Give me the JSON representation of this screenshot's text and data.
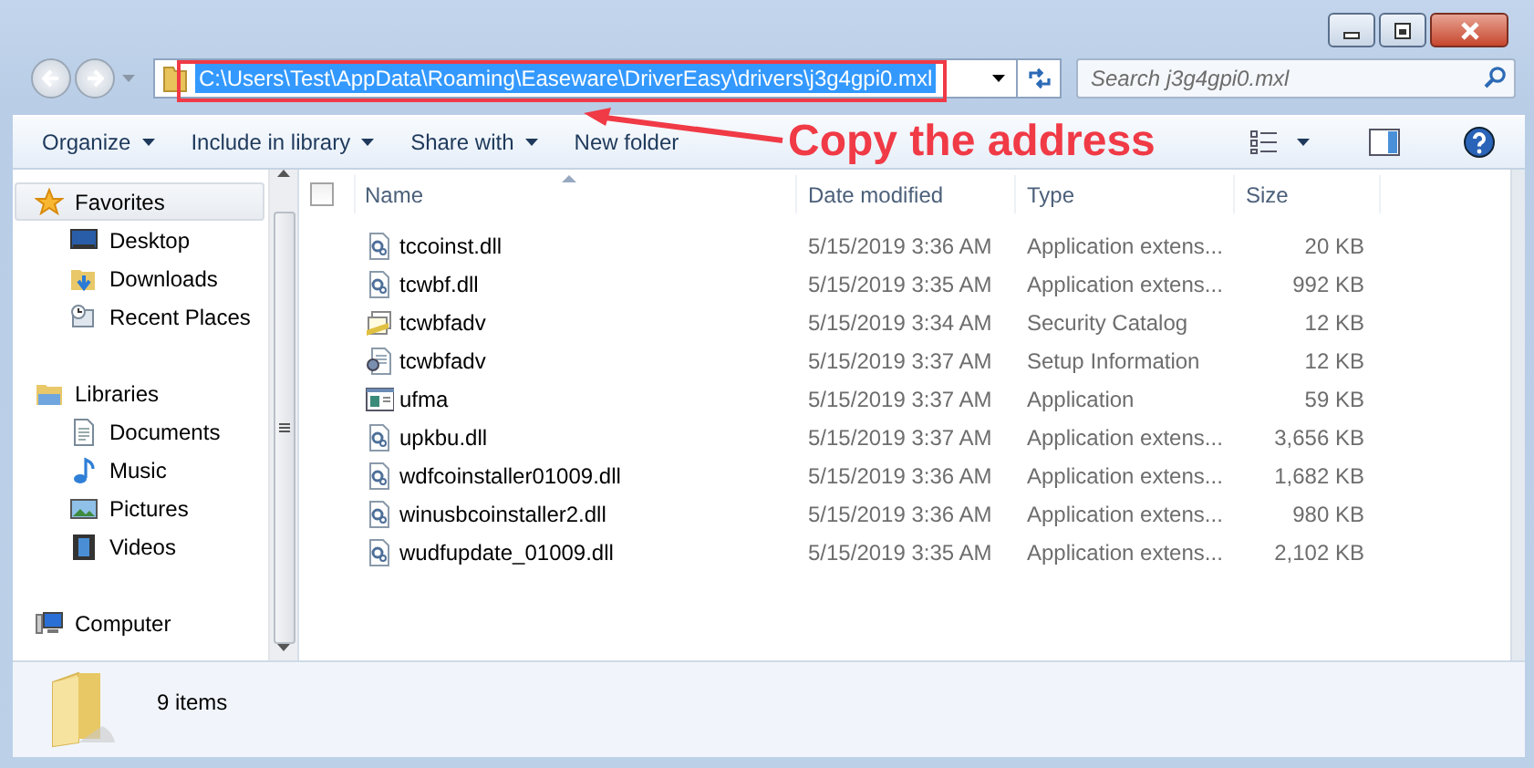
{
  "address": {
    "path": "C:\\Users\\Test\\AppData\\Roaming\\Easeware\\DriverEasy\\drivers\\j3g4gpi0.mxl",
    "selected": true
  },
  "search": {
    "placeholder": "Search j3g4gpi0.mxl"
  },
  "toolbar": [
    {
      "label": "Organize",
      "dropdown": true
    },
    {
      "label": "Include in library",
      "dropdown": true
    },
    {
      "label": "Share with",
      "dropdown": true
    },
    {
      "label": "New folder",
      "dropdown": false
    }
  ],
  "nav": [
    {
      "label": "Favorites",
      "kind": "star",
      "selected": true,
      "children": [
        {
          "label": "Desktop",
          "kind": "desktop",
          "selected": false
        },
        {
          "label": "Downloads",
          "kind": "downloads",
          "selected": false
        },
        {
          "label": "Recent Places",
          "kind": "recent",
          "selected": false
        }
      ]
    },
    {
      "label": "Libraries",
      "kind": "libraries",
      "selected": false,
      "children": [
        {
          "label": "Documents",
          "kind": "documents",
          "selected": false
        },
        {
          "label": "Music",
          "kind": "music",
          "selected": false
        },
        {
          "label": "Pictures",
          "kind": "pictures",
          "selected": false
        },
        {
          "label": "Videos",
          "kind": "videos",
          "selected": false
        }
      ]
    },
    {
      "label": "Computer",
      "kind": "computer",
      "selected": false
    }
  ],
  "files": {
    "select_all_checked": false,
    "columns": [
      {
        "label": "Name",
        "sorted": true
      },
      {
        "label": "Date modified",
        "sorted": false
      },
      {
        "label": "Type",
        "sorted": false
      },
      {
        "label": "Size",
        "sorted": false
      }
    ],
    "rows": [
      {
        "kind": "dll",
        "name": "tccoinst.dll",
        "date": "5/15/2019 3:36 AM",
        "type": "Application extens...",
        "size": "20 KB"
      },
      {
        "kind": "dll",
        "name": "tcwbf.dll",
        "date": "5/15/2019 3:35 AM",
        "type": "Application extens...",
        "size": "992 KB"
      },
      {
        "kind": "catalog",
        "name": "tcwbfadv",
        "date": "5/15/2019 3:34 AM",
        "type": "Security Catalog",
        "size": "12 KB"
      },
      {
        "kind": "setup",
        "name": "tcwbfadv",
        "date": "5/15/2019 3:37 AM",
        "type": "Setup Information",
        "size": "12 KB"
      },
      {
        "kind": "application",
        "name": "ufma",
        "date": "5/15/2019 3:37 AM",
        "type": "Application",
        "size": "59 KB"
      },
      {
        "kind": "dll",
        "name": "upkbu.dll",
        "date": "5/15/2019 3:37 AM",
        "type": "Application extens...",
        "size": "3,656 KB"
      },
      {
        "kind": "dll",
        "name": "wdfcoinstaller01009.dll",
        "date": "5/15/2019 3:36 AM",
        "type": "Application extens...",
        "size": "1,682 KB"
      },
      {
        "kind": "dll",
        "name": "winusbcoinstaller2.dll",
        "date": "5/15/2019 3:36 AM",
        "type": "Application extens...",
        "size": "980 KB"
      },
      {
        "kind": "dll",
        "name": "wudfupdate_01009.dll",
        "date": "5/15/2019 3:35 AM",
        "type": "Application extens...",
        "size": "2,102 KB"
      }
    ]
  },
  "status": {
    "text": "9 items"
  },
  "callout": {
    "text": "Copy the address"
  }
}
